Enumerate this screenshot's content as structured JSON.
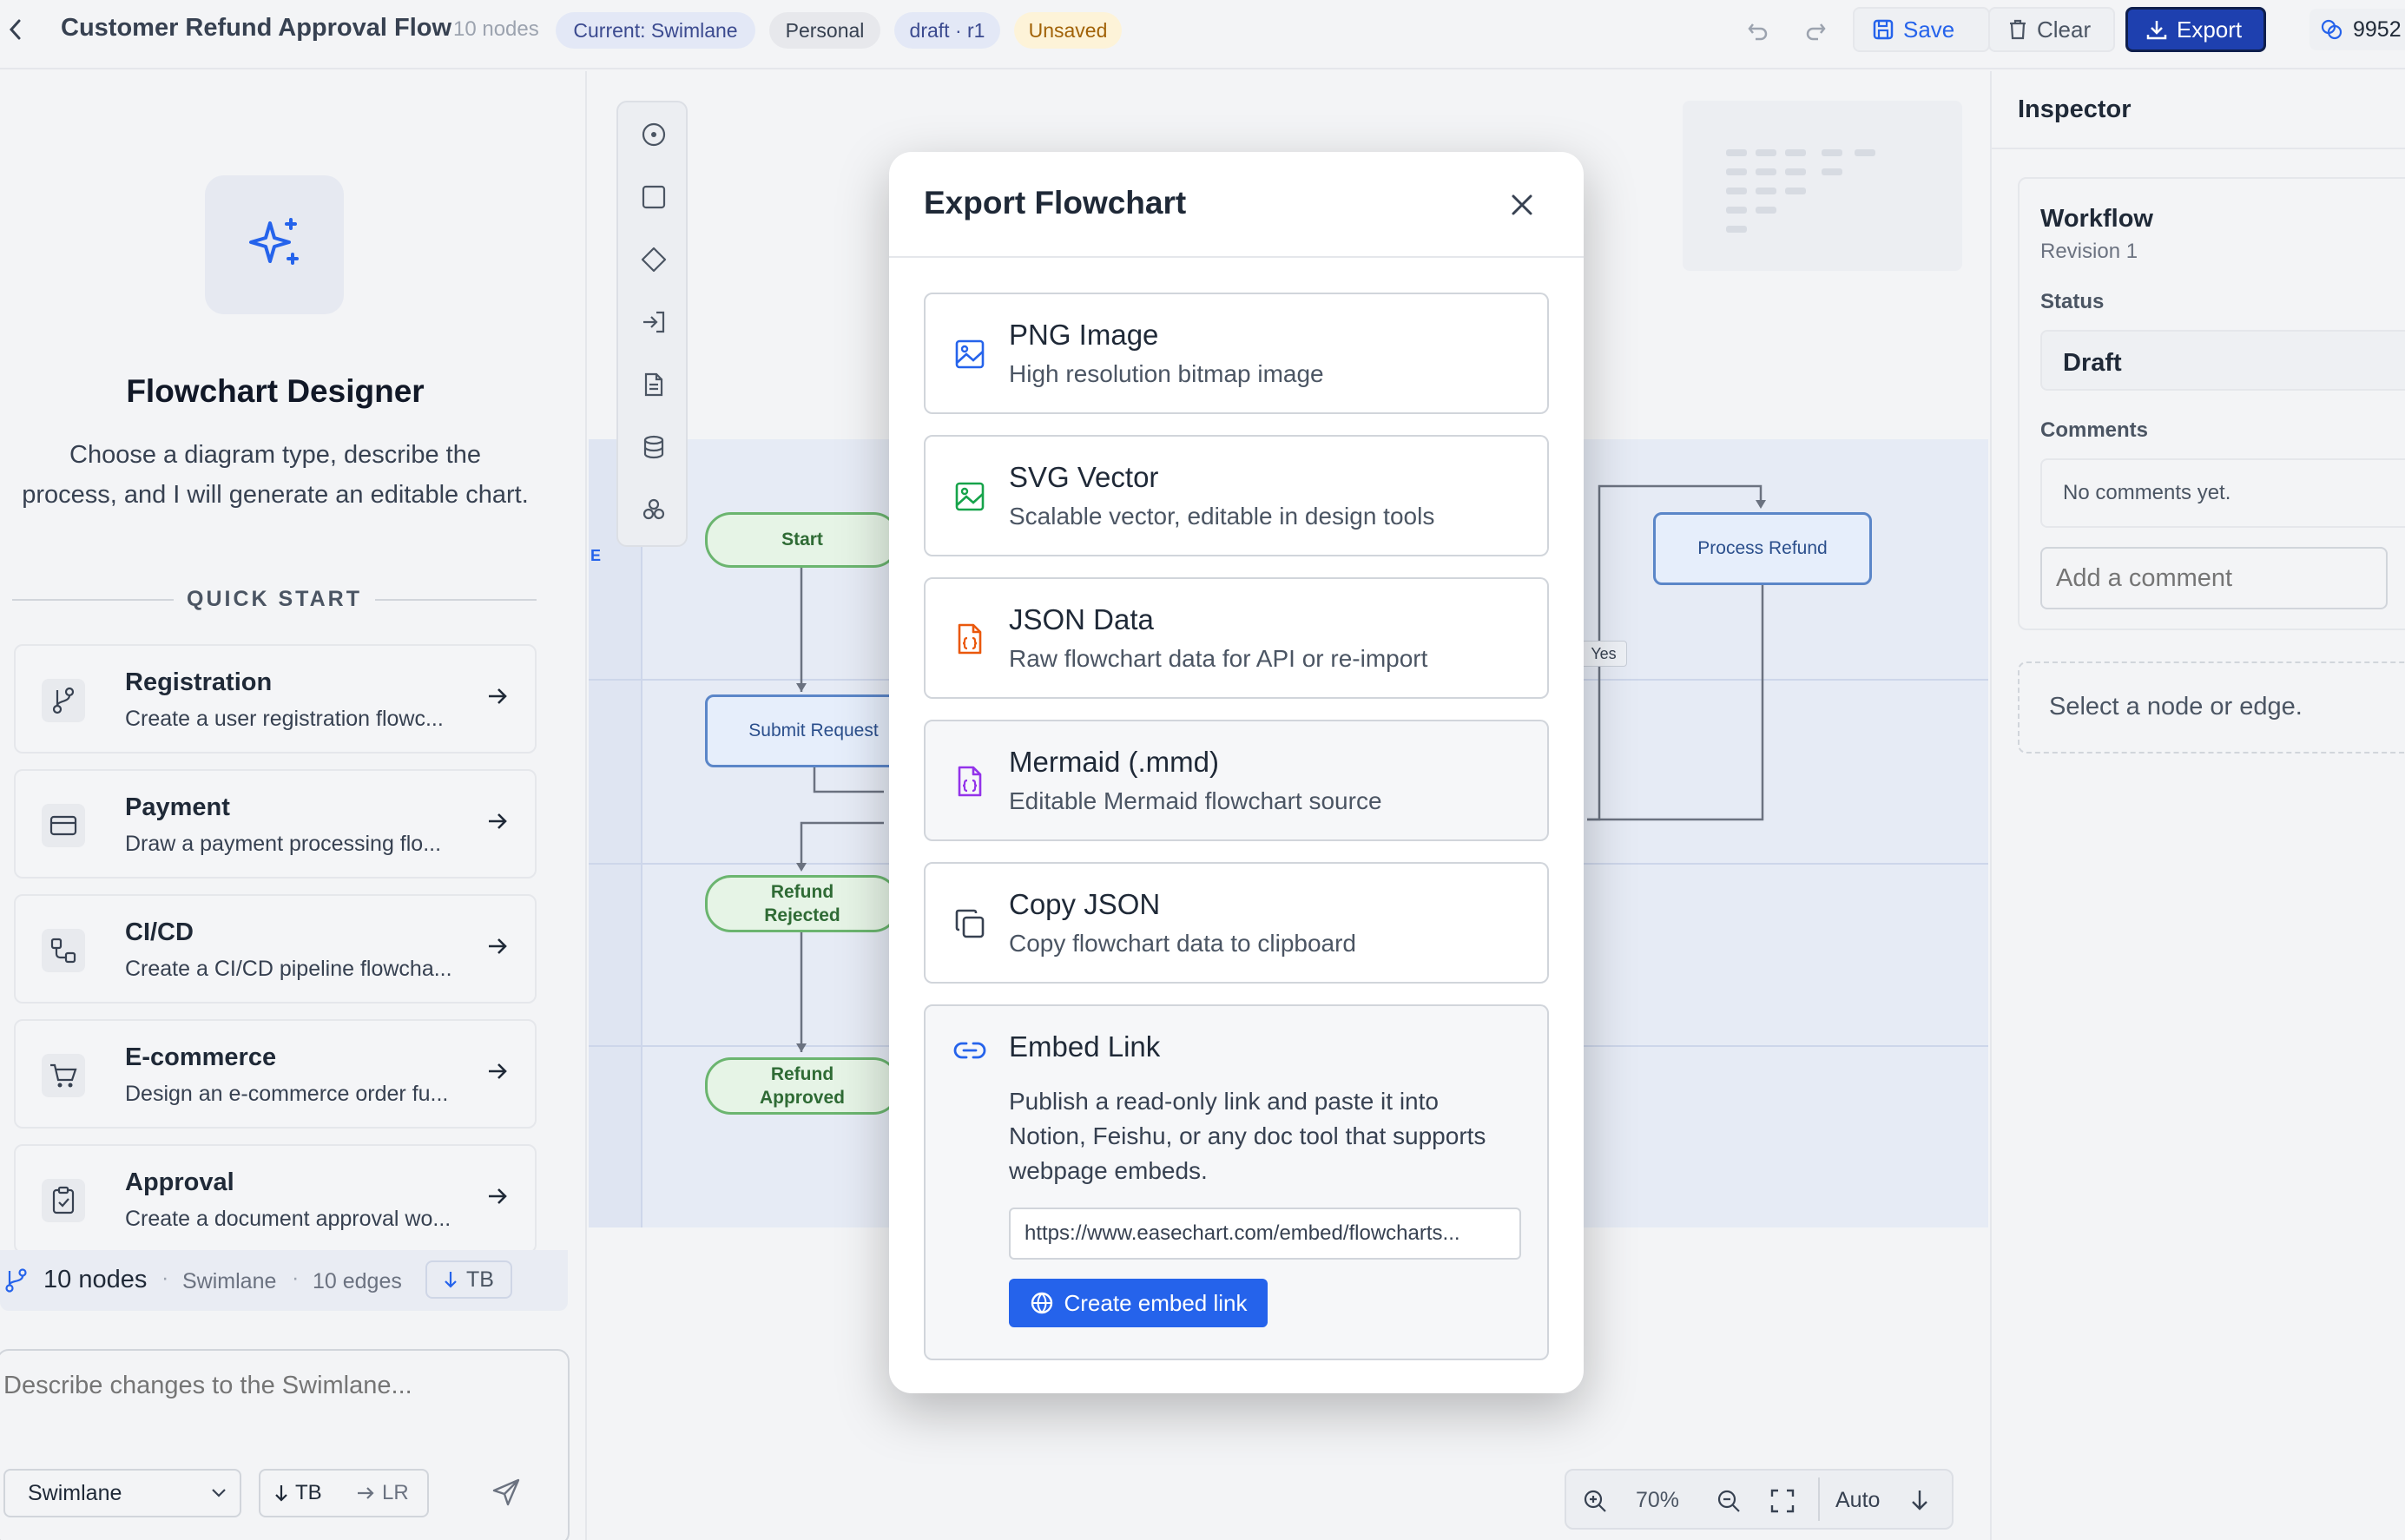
{
  "header": {
    "title": "Customer Refund Approval Flow",
    "node_count": "10 nodes",
    "chips": {
      "current": "Current: Swimlane",
      "personal": "Personal",
      "draft": "draft · r1",
      "unsaved": "Unsaved"
    },
    "save_label": "Save",
    "clear_label": "Clear",
    "export_label": "Export",
    "credits": "9952"
  },
  "left": {
    "hero_title": "Flowchart Designer",
    "hero_desc_line1": "Choose a diagram type, describe the",
    "hero_desc_line2": "process, and I will generate an editable chart.",
    "quick_start": "QUICK START",
    "templates": [
      {
        "title": "Registration",
        "desc": "Create a user registration flowc...",
        "icon": "branch-icon"
      },
      {
        "title": "Payment",
        "desc": "Draw a payment processing flo...",
        "icon": "credit-card-icon"
      },
      {
        "title": "CI/CD",
        "desc": "Create a CI/CD pipeline flowcha...",
        "icon": "pipeline-icon"
      },
      {
        "title": "E-commerce",
        "desc": "Design an e-commerce order fu...",
        "icon": "cart-icon"
      },
      {
        "title": "Approval",
        "desc": "Create a document approval wo...",
        "icon": "clipboard-check-icon"
      }
    ],
    "status": {
      "nodes": "10 nodes",
      "type": "Swimlane",
      "edges": "10 edges",
      "direction": "TB"
    },
    "prompt_placeholder": "Describe changes to the Swimlane...",
    "diagram_type": "Swimlane",
    "dir_tb": "TB",
    "dir_lr": "LR"
  },
  "canvas": {
    "nodes": {
      "start": "Start",
      "submit": "Submit Request",
      "rejected_1": "Refund",
      "rejected_2": "Rejected",
      "approved_1": "Refund",
      "approved_2": "Approved",
      "process": "Process Refund"
    },
    "edge_yes": "Yes",
    "lane_letter": "E",
    "zoom": "70%",
    "layout_mode": "Auto"
  },
  "inspector": {
    "title": "Inspector",
    "workflow": "Workflow",
    "revision": "Revision 1",
    "status_label": "Status",
    "status_value": "Draft",
    "comments_label": "Comments",
    "no_comments": "No comments yet.",
    "add_comment_placeholder": "Add a comment",
    "select_hint": "Select a node or edge."
  },
  "modal": {
    "title": "Export Flowchart",
    "options": [
      {
        "title": "PNG Image",
        "desc": "High resolution bitmap image",
        "color": "#2563eb"
      },
      {
        "title": "SVG Vector",
        "desc": "Scalable vector, editable in design tools",
        "color": "#16a34a"
      },
      {
        "title": "JSON Data",
        "desc": "Raw flowchart data for API or re-import",
        "color": "#ea580c"
      },
      {
        "title": "Mermaid (.mmd)",
        "desc": "Editable Mermaid flowchart source",
        "color": "#9333ea"
      },
      {
        "title": "Copy JSON",
        "desc": "Copy flowchart data to clipboard",
        "color": "#374151"
      }
    ],
    "embed": {
      "title": "Embed Link",
      "desc_line1": "Publish a read-only link and paste it into",
      "desc_line2": "Notion, Feishu, or any doc tool that supports",
      "desc_line3": "webpage embeds.",
      "url": "https://www.easechart.com/embed/flowcharts...",
      "button": "Create embed link"
    }
  },
  "colors": {
    "accent": "#2563eb",
    "export_button": "#1e40af",
    "unsaved_bg": "#fdf3d8",
    "unsaved_text": "#a16207"
  }
}
